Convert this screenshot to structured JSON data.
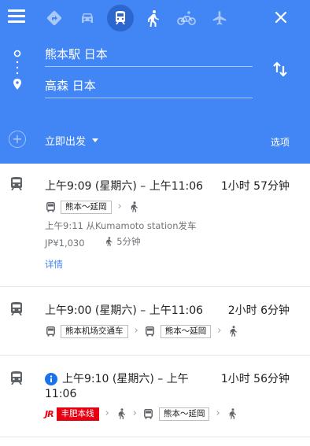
{
  "colors": {
    "header": "#4285f4",
    "selected_mode": "#2c66cf",
    "link": "#4285f4",
    "rail_red": "#e60012"
  },
  "icons": {
    "menu": "hamburger-menu-icon",
    "modes": [
      "best-route-icon",
      "car-icon",
      "transit-icon",
      "walk-icon",
      "bicycle-icon",
      "flight-icon"
    ],
    "close": "close-icon",
    "swap": "swap-icon",
    "route": "transit-icon"
  },
  "search": {
    "origin": "熊本駅 日本",
    "destination": "高森 日本",
    "depart_label": "立即出发",
    "options_label": "选项"
  },
  "routes": [
    {
      "times": "上午9:09 (星期六) – 上午11:06",
      "duration": "1小时 57分钟",
      "steps": [
        "熊本～延岡"
      ],
      "departure": "上午9:11 从Kumamoto station发车",
      "fare": "JP¥1,030",
      "walk": "5分钟",
      "details_label": "详情"
    },
    {
      "times": "上午9:00 (星期六) – 上午11:06",
      "duration": "2小时 6分钟",
      "steps": [
        "熊本机场交通车",
        "熊本～延岡"
      ]
    },
    {
      "times_line1": "上午9:10 (星期六) – 上午",
      "times_line2": "11:06",
      "duration": "1小时 56分钟",
      "rail_badge": "JR",
      "rail_line": "丰肥本线",
      "steps": [
        "熊本～延岡"
      ]
    }
  ]
}
